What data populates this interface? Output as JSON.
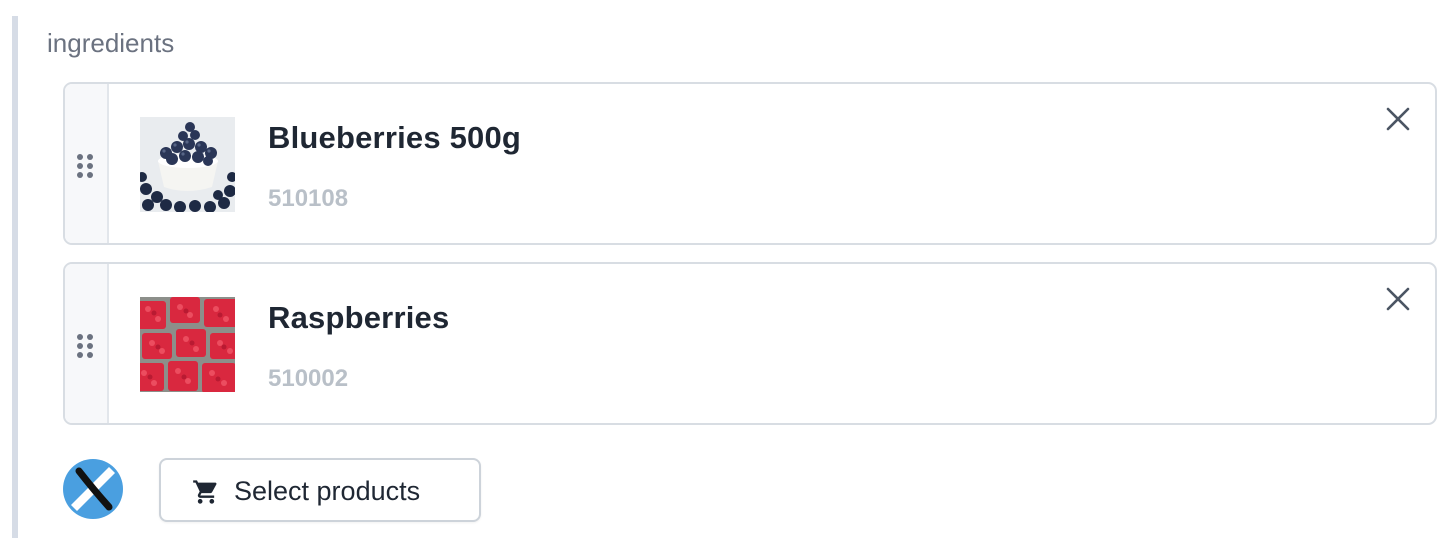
{
  "field": {
    "label": "ingredients"
  },
  "items": [
    {
      "title": "Blueberries 500g",
      "sku": "510108",
      "image": "blueberries-bowl-photo"
    },
    {
      "title": "Raspberries",
      "sku": "510002",
      "image": "raspberries-punnets-photo"
    }
  ],
  "actions": {
    "select_products_label": "Select products"
  },
  "icons": {
    "drag": "drag-handle-icon",
    "remove": "close-icon",
    "cart": "cart-icon",
    "brand": "brand-logo"
  },
  "colors": {
    "field_border": "#d6dce6",
    "title": "#1f2733",
    "sku": "#b9c0c8",
    "brand_blue": "#4a9fe0"
  }
}
